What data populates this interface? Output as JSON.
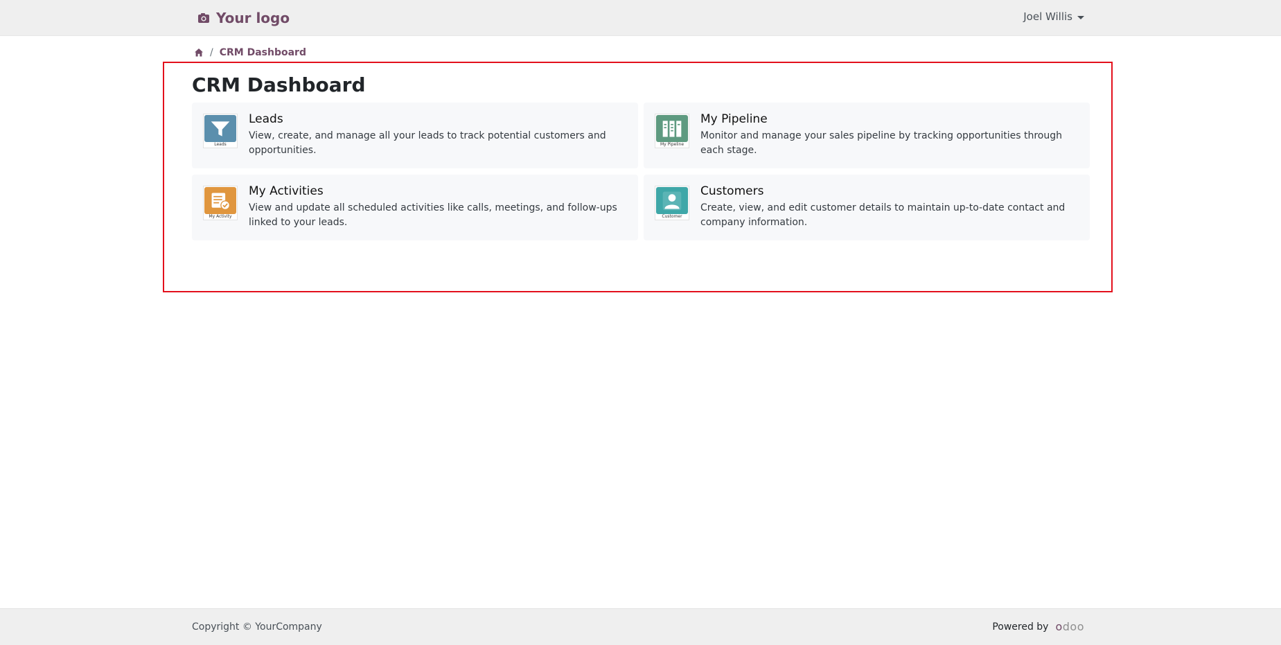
{
  "navbar": {
    "logo_text": "Your logo",
    "user_name": "Joel Willis"
  },
  "breadcrumb": {
    "current": "CRM Dashboard",
    "separator": "/"
  },
  "page": {
    "title": "CRM Dashboard"
  },
  "cards": [
    {
      "title": "Leads",
      "icon_caption": "Leads",
      "description": "View, create, and manage all your leads to track potential customers and opportunities.",
      "icon": "funnel-icon",
      "color": "#5b8fad"
    },
    {
      "title": "My Pipeline",
      "icon_caption": "My Pipeline",
      "description": "Monitor and manage your sales pipeline by tracking opportunities through each stage.",
      "icon": "kanban-icon",
      "color": "#5e9a80"
    },
    {
      "title": "My Activities",
      "icon_caption": "My Activity",
      "description": "View and update all scheduled activities like calls, meetings, and follow-ups linked to your leads.",
      "icon": "activity-icon",
      "color": "#e0963e"
    },
    {
      "title": "Customers",
      "icon_caption": "Customer",
      "description": "Create, view, and edit customer details to maintain up-to-date contact and company information.",
      "icon": "customer-icon",
      "color": "#3fa7a8"
    }
  ],
  "footer": {
    "copyright": "Copyright © YourCompany",
    "powered_by": "Powered by",
    "brand_o": "o",
    "brand_rest": "doo"
  },
  "colors": {
    "brand": "#714b67",
    "highlight": "#e3101c",
    "navbar_bg": "#efefef",
    "card_bg": "#f7f8fa"
  }
}
